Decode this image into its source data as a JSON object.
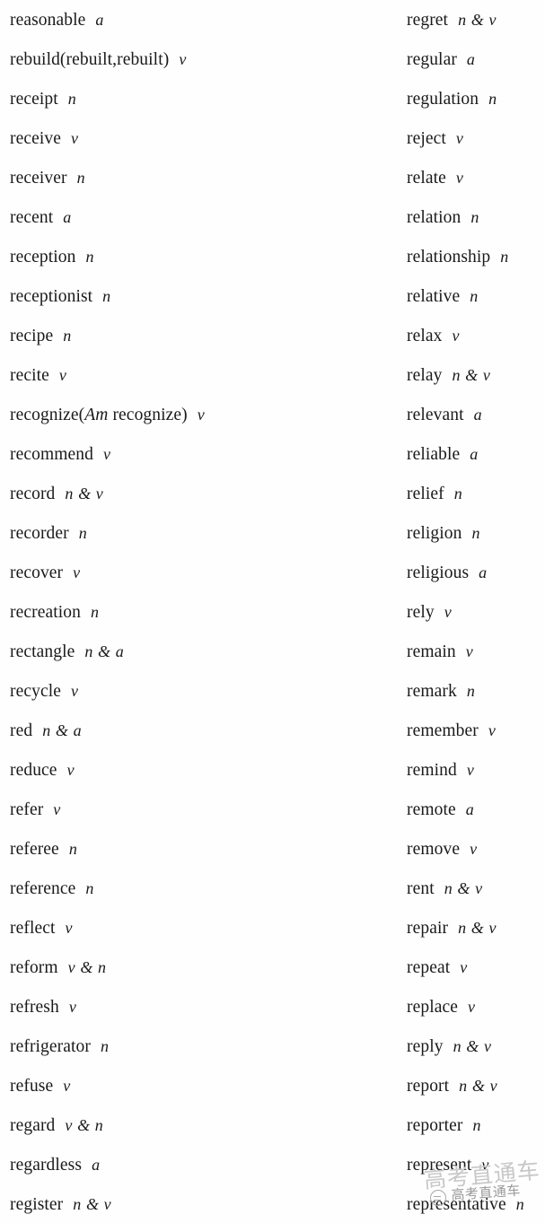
{
  "document": {
    "title": "English Vocabulary List (re-)",
    "background_color": "#fefefe",
    "text_color": "#1a1a1a"
  },
  "columns": {
    "left": {
      "name": "left-vocabulary-column",
      "entries": [
        {
          "word": "reasonable",
          "pos": "a"
        },
        {
          "word": "rebuild(rebuilt,rebuilt)",
          "pos": "v"
        },
        {
          "word": "receipt",
          "pos": "n"
        },
        {
          "word": "receive",
          "pos": "v"
        },
        {
          "word": "receiver",
          "pos": "n"
        },
        {
          "word": "recent",
          "pos": "a"
        },
        {
          "word": "reception",
          "pos": "n"
        },
        {
          "word": "receptionist",
          "pos": "n"
        },
        {
          "word": "recipe",
          "pos": "n"
        },
        {
          "word": "recite",
          "pos": "v"
        },
        {
          "word": "recognize(Am recognize)",
          "pos": "v",
          "italic_segment": "Am"
        },
        {
          "word": "recommend",
          "pos": "v"
        },
        {
          "word": "record",
          "pos": "n & v"
        },
        {
          "word": "recorder",
          "pos": "n"
        },
        {
          "word": "recover",
          "pos": "v"
        },
        {
          "word": "recreation",
          "pos": "n"
        },
        {
          "word": "rectangle",
          "pos": "n & a"
        },
        {
          "word": "recycle",
          "pos": "v"
        },
        {
          "word": "red",
          "pos": "n & a"
        },
        {
          "word": "reduce",
          "pos": "v"
        },
        {
          "word": "refer",
          "pos": "v"
        },
        {
          "word": "referee",
          "pos": "n"
        },
        {
          "word": "reference",
          "pos": "n"
        },
        {
          "word": "reflect",
          "pos": "v"
        },
        {
          "word": "reform",
          "pos": "v & n"
        },
        {
          "word": "refresh",
          "pos": "v"
        },
        {
          "word": "refrigerator",
          "pos": "n"
        },
        {
          "word": "refuse",
          "pos": "v"
        },
        {
          "word": "regard",
          "pos": "v & n"
        },
        {
          "word": "regardless",
          "pos": "a"
        },
        {
          "word": "register",
          "pos": "n & v"
        }
      ]
    },
    "right": {
      "name": "right-vocabulary-column",
      "entries": [
        {
          "word": "regret",
          "pos": "n & v"
        },
        {
          "word": "regular",
          "pos": "a"
        },
        {
          "word": "regulation",
          "pos": "n"
        },
        {
          "word": "reject",
          "pos": "v"
        },
        {
          "word": "relate",
          "pos": "v"
        },
        {
          "word": "relation",
          "pos": "n"
        },
        {
          "word": "relationship",
          "pos": "n"
        },
        {
          "word": "relative",
          "pos": "n"
        },
        {
          "word": "relax",
          "pos": "v"
        },
        {
          "word": "relay",
          "pos": "n & v"
        },
        {
          "word": "relevant",
          "pos": "a"
        },
        {
          "word": "reliable",
          "pos": "a"
        },
        {
          "word": "relief",
          "pos": "n"
        },
        {
          "word": "religion",
          "pos": "n"
        },
        {
          "word": "religious",
          "pos": "a"
        },
        {
          "word": "rely",
          "pos": "v"
        },
        {
          "word": "remain",
          "pos": "v"
        },
        {
          "word": "remark",
          "pos": "n"
        },
        {
          "word": "remember",
          "pos": "v"
        },
        {
          "word": "remind",
          "pos": "v"
        },
        {
          "word": "remote",
          "pos": "a"
        },
        {
          "word": "remove",
          "pos": "v"
        },
        {
          "word": "rent",
          "pos": "n & v"
        },
        {
          "word": "repair",
          "pos": "n & v"
        },
        {
          "word": "repeat",
          "pos": "v"
        },
        {
          "word": "replace",
          "pos": "v"
        },
        {
          "word": "reply",
          "pos": "n & v"
        },
        {
          "word": "report",
          "pos": "n & v"
        },
        {
          "word": "reporter",
          "pos": "n"
        },
        {
          "word": "represent",
          "pos": "v"
        },
        {
          "word": "representative",
          "pos": "n"
        }
      ]
    }
  },
  "watermarks": {
    "large": {
      "text": "高考直通车",
      "color": "#c8c8c8"
    },
    "small": {
      "text": "高考直通车",
      "color": "#9a9a9a"
    }
  }
}
